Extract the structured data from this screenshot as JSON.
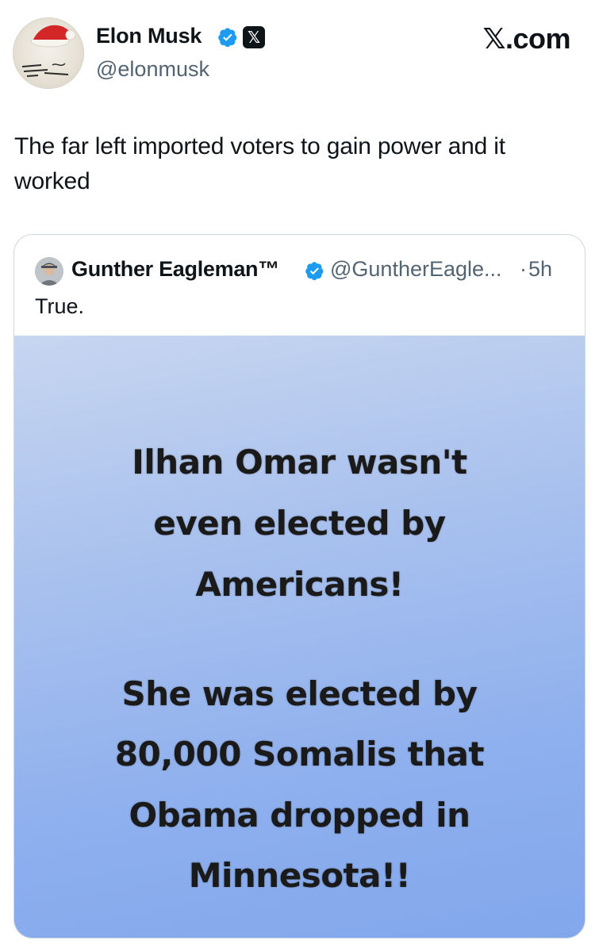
{
  "post": {
    "author_name": "Elon Musk",
    "handle": "@elonmusk",
    "site": "𝕏.com",
    "affiliate_badge": "𝕏",
    "text": "The far left imported voters to gain power and it worked"
  },
  "quote": {
    "author_name": "Gunther Eagleman™",
    "handle": "@GuntherEagle...",
    "separator": "·",
    "time": "5h",
    "text": "True.",
    "image_text": {
      "line1": "Ilhan Omar wasn't",
      "line2": "even elected by",
      "line3": "Americans!",
      "line4": "She was elected by",
      "line5": "80,000 Somalis that",
      "line6": "Obama dropped in",
      "line7": "Minnesota!!"
    }
  },
  "colors": {
    "verified_blue": "#1d9bf0",
    "secondary_text": "#536471",
    "border": "#cfd9de"
  },
  "icons": {
    "verified": "verified-badge-icon",
    "affiliate": "x-logo-icon",
    "avatar_hat": "santa-hat"
  }
}
